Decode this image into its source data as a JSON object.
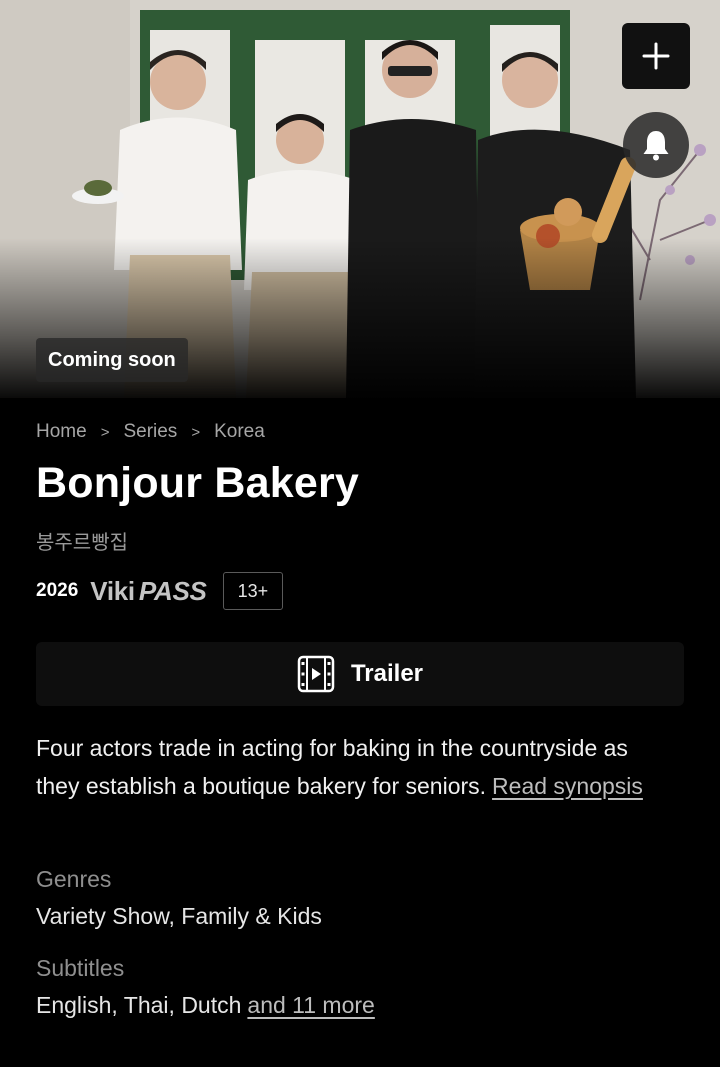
{
  "hero": {
    "badge": "Coming soon",
    "add_icon": "plus-icon",
    "bell_icon": "bell-icon"
  },
  "breadcrumb": {
    "items": [
      "Home",
      "Series",
      "Korea"
    ],
    "separator": ">"
  },
  "show": {
    "title": "Bonjour Bakery",
    "native_title": "봉주르빵집",
    "year": "2026",
    "vikipass_viki": "Viki",
    "vikipass_pass": "PASS",
    "rating": "13+"
  },
  "trailer": {
    "label": "Trailer",
    "icon": "film-play-icon"
  },
  "synopsis": {
    "text": "Four actors trade in acting for baking in the countryside as they establish a boutique bakery for seniors.",
    "link": "Read synopsis"
  },
  "genres": {
    "label": "Genres",
    "value": "Variety Show, Family & Kids"
  },
  "subtitles": {
    "label": "Subtitles",
    "value": "English, Thai, Dutch",
    "more_link": "and 11 more"
  }
}
